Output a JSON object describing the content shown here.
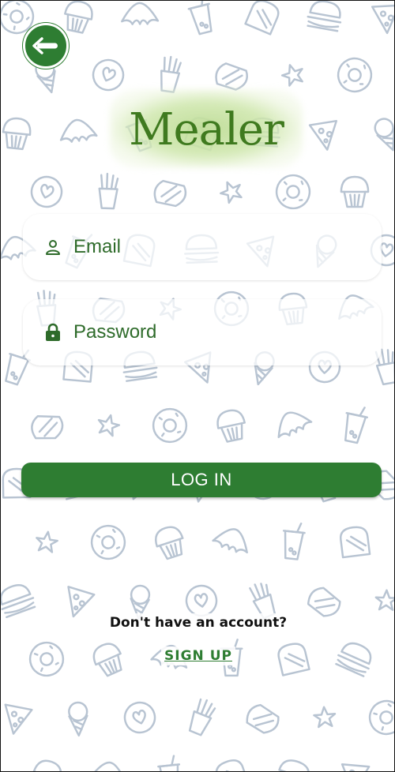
{
  "app": {
    "logo_text": "Mealer"
  },
  "login_form": {
    "email_placeholder": "Email",
    "password_placeholder": "Password",
    "login_button_label": "LOG IN"
  },
  "signup": {
    "prompt": "Don't have an account?",
    "link_label": "SIGN UP"
  },
  "icons": {
    "back": "arrow-left-icon",
    "email": "user-icon",
    "password": "lock-icon"
  },
  "colors": {
    "primary": "#2e7d32",
    "field_text": "#2e6b2a",
    "doodle_stroke": "#b8c4d2",
    "logo_text": "#3f7a1f"
  }
}
